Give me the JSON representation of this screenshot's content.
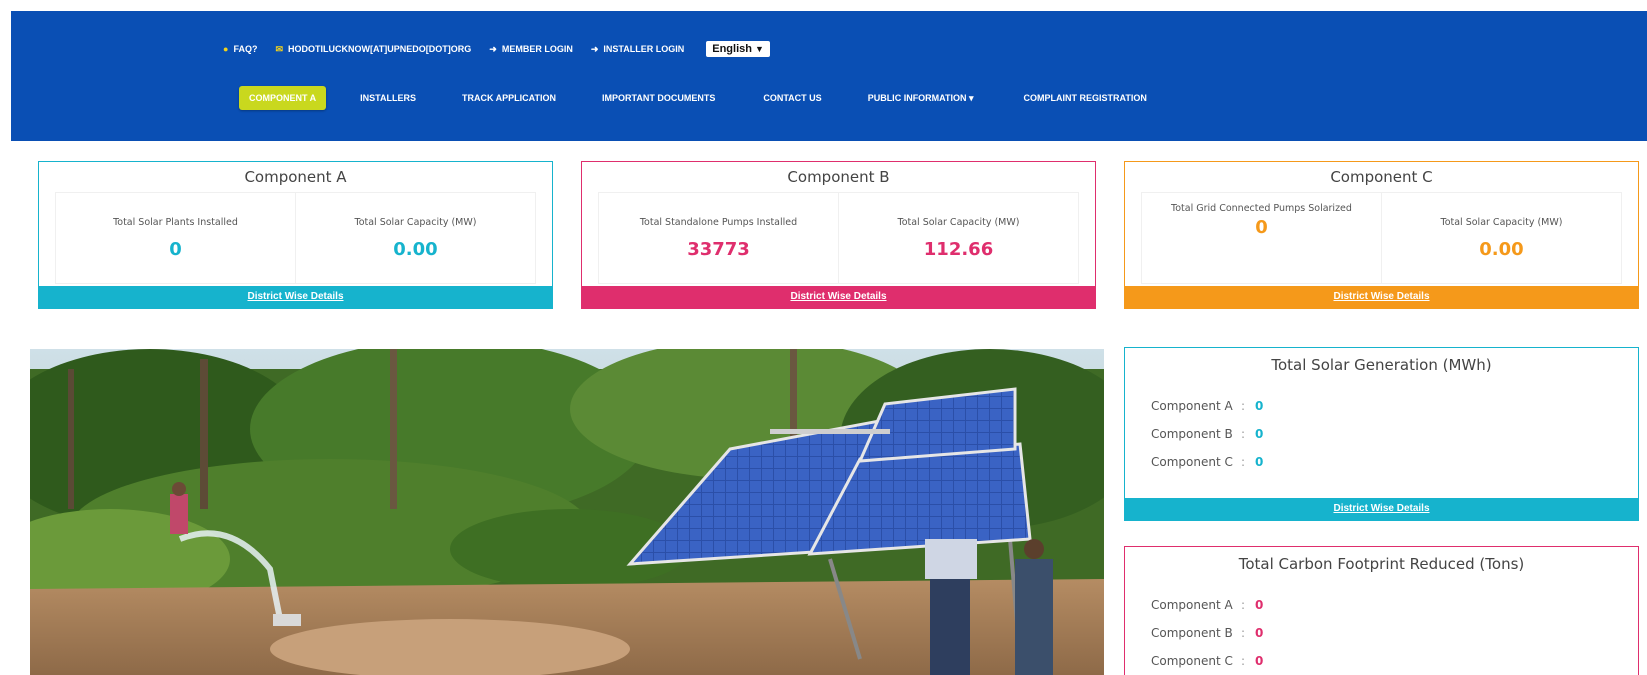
{
  "header": {
    "topbar": [
      {
        "icon": "question-circle-icon",
        "label": "FAQ?"
      },
      {
        "icon": "envelope-icon",
        "label": "HODOTILUCKNOW[AT]UPNEDO[DOT]ORG"
      },
      {
        "icon": "login-icon",
        "label": "MEMBER LOGIN"
      },
      {
        "icon": "login-icon",
        "label": "INSTALLER LOGIN"
      }
    ],
    "language": "English",
    "nav": [
      "COMPONENT A",
      "INSTALLERS",
      "TRACK APPLICATION",
      "IMPORTANT DOCUMENTS",
      "CONTACT US",
      "PUBLIC INFORMATION ▾",
      "COMPLAINT REGISTRATION"
    ]
  },
  "components": {
    "a": {
      "title": "Component A",
      "label1": "Total Solar Plants Installed",
      "value1": "0",
      "label2": "Total Solar Capacity (MW)",
      "value2": "0.00",
      "link": "District Wise Details"
    },
    "b": {
      "title": "Component B",
      "label1": "Total Standalone Pumps Installed",
      "value1": "33773",
      "label2": "Total Solar Capacity (MW)",
      "value2": "112.66",
      "link": "District Wise Details"
    },
    "c": {
      "title": "Component C",
      "label1": "Total Grid Connected Pumps Solarized",
      "value1": "0",
      "label2": "Total Solar Capacity (MW)",
      "value2": "0.00",
      "link": "District Wise Details"
    }
  },
  "generation": {
    "title": "Total Solar Generation (MWh)",
    "rows": [
      {
        "label": "Component A",
        "value": "0"
      },
      {
        "label": "Component B",
        "value": "0"
      },
      {
        "label": "Component C",
        "value": "0"
      }
    ],
    "link": "District Wise Details"
  },
  "carbon": {
    "title": "Total Carbon Footprint Reduced (Tons)",
    "rows": [
      {
        "label": "Component A",
        "value": "0"
      },
      {
        "label": "Component B",
        "value": "0"
      },
      {
        "label": "Component C",
        "value": "0"
      }
    ]
  },
  "colors": {
    "header_bg": "#0a4fb4",
    "active_nav": "#c9d81e",
    "component_a": "#16b3cd",
    "component_b": "#df2e6d",
    "component_c": "#f5991a"
  }
}
